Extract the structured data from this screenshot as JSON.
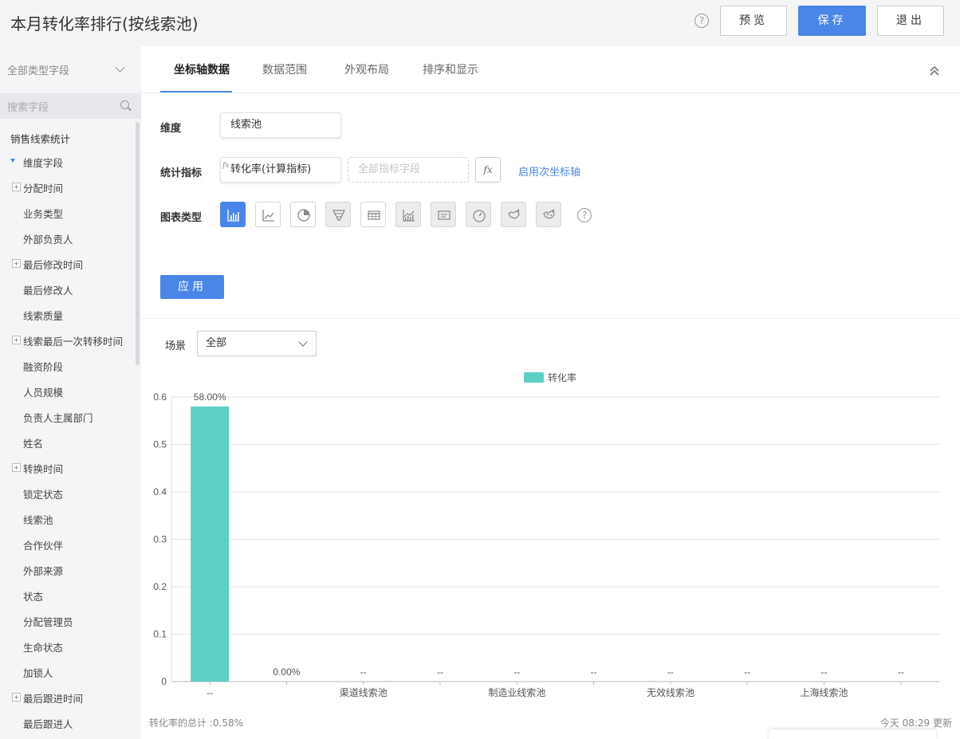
{
  "header": {
    "title": "本月转化率排行(按线索池)",
    "help_icon": "?",
    "preview_label": "预览",
    "save_label": "保存",
    "exit_label": "退出"
  },
  "sidebar": {
    "field_type_selector": "全部类型字段",
    "search_placeholder": "搜索字段",
    "root": "销售线索统计",
    "group_label": "维度字段",
    "items": [
      {
        "label": "分配时间",
        "expandable": true
      },
      {
        "label": "业务类型",
        "expandable": false
      },
      {
        "label": "外部负责人",
        "expandable": false
      },
      {
        "label": "最后修改时间",
        "expandable": true
      },
      {
        "label": "最后修改人",
        "expandable": false
      },
      {
        "label": "线索质量",
        "expandable": false
      },
      {
        "label": "线索最后一次转移时间",
        "expandable": true
      },
      {
        "label": "融资阶段",
        "expandable": false
      },
      {
        "label": "人员规模",
        "expandable": false
      },
      {
        "label": "负责人主属部门",
        "expandable": false
      },
      {
        "label": "姓名",
        "expandable": false
      },
      {
        "label": "转换时间",
        "expandable": true
      },
      {
        "label": "锁定状态",
        "expandable": false
      },
      {
        "label": "线索池",
        "expandable": false
      },
      {
        "label": "合作伙伴",
        "expandable": false
      },
      {
        "label": "外部来源",
        "expandable": false
      },
      {
        "label": "状态",
        "expandable": false
      },
      {
        "label": "分配管理员",
        "expandable": false
      },
      {
        "label": "生命状态",
        "expandable": false
      },
      {
        "label": "加锁人",
        "expandable": false
      },
      {
        "label": "最后跟进时间",
        "expandable": true
      },
      {
        "label": "最后跟进人",
        "expandable": false
      }
    ]
  },
  "tabs": [
    "坐标轴数据",
    "数据范围",
    "外观布局",
    "排序和显示"
  ],
  "active_tab": "坐标轴数据",
  "form": {
    "dimension_label": "维度",
    "dimension_value": "线索池",
    "metric_label": "统计指标",
    "metric_value": "转化率(计算指标)",
    "metric_fx_mark": "fx",
    "metric_placeholder": "全部指标字段",
    "fx_button": "fx",
    "secondary_axis_link": "启用次坐标轴",
    "chart_type_label": "图表类型",
    "chart_types": [
      "bar-chart-icon",
      "line-chart-icon",
      "pie-chart-icon",
      "funnel-chart-icon",
      "table-chart-icon",
      "area-chart-icon",
      "text-card-icon",
      "gauge-chart-icon",
      "china-map-icon",
      "world-map-icon"
    ],
    "chart_type_help": "?",
    "apply_label": "应用"
  },
  "scene": {
    "label": "场景",
    "value": "全部"
  },
  "colors": {
    "accent": "#4a86e8",
    "bar": "#5ecfc5"
  },
  "chart_data": {
    "type": "bar",
    "categories": [
      "--",
      "",
      "渠道线索池",
      "",
      "制造业线索池",
      "",
      "无效线索池",
      "",
      "上海线索池",
      ""
    ],
    "series": [
      {
        "name": "转化率",
        "values": [
          0.58,
          0,
          null,
          null,
          null,
          null,
          null,
          null,
          null,
          null
        ]
      }
    ],
    "data_labels": [
      "58.00%",
      "0.00%",
      "--",
      "--",
      "--",
      "--",
      "--",
      "--",
      "--",
      "--"
    ],
    "ylim": [
      0,
      0.6
    ],
    "yticks": [
      "0",
      "0.1",
      "0.2",
      "0.3",
      "0.4",
      "0.5",
      "0.6"
    ],
    "grid": true,
    "legend_position": "top"
  },
  "footer": {
    "total": "转化率的总计 :0.58%",
    "updated": "今天 08:29 更新"
  }
}
